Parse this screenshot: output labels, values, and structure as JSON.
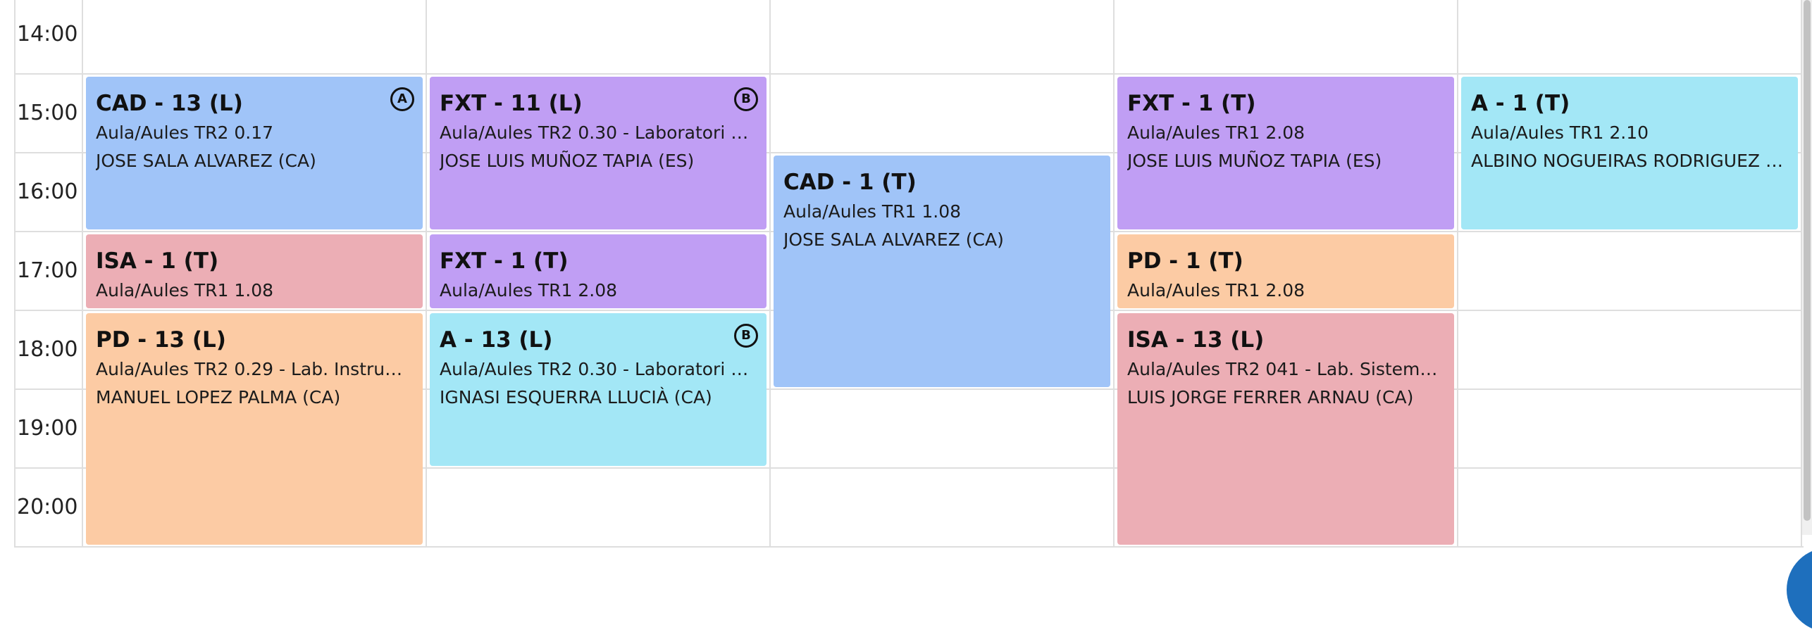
{
  "colors": {
    "blue": "#a0c4f8",
    "purple": "#c09ef4",
    "pink": "#ecaeb5",
    "orange": "#fccba4",
    "cyan": "#a3e7f6",
    "grid": "#dedede",
    "accent": "#1e6fbd"
  },
  "time_labels": [
    "14:00",
    "15:00",
    "16:00",
    "17:00",
    "18:00",
    "19:00",
    "20:00"
  ],
  "events": [
    {
      "day": 0,
      "start": 15,
      "end": 17,
      "color": "blue",
      "title": "CAD - 13 (L)",
      "badge": "A",
      "lines": [
        "Aula/Aules TR2 0.17",
        "JOSE SALA ALVAREZ (CA)"
      ]
    },
    {
      "day": 0,
      "start": 17,
      "end": 18,
      "color": "pink",
      "title": "ISA - 1 (T)",
      "badge": "",
      "lines": [
        "Aula/Aules TR1 1.08"
      ]
    },
    {
      "day": 0,
      "start": 18,
      "end": 21,
      "color": "orange",
      "title": "PD - 13 (L)",
      "badge": "",
      "lines": [
        "Aula/Aules TR2 0.29 - Lab. Instrum....",
        "MANUEL LOPEZ PALMA (CA)"
      ]
    },
    {
      "day": 1,
      "start": 15,
      "end": 17,
      "color": "purple",
      "title": "FXT - 11 (L)",
      "badge": "B",
      "lines": [
        "Aula/Aules TR2 0.30 - Laboratori À...",
        "JOSE LUIS MUÑOZ TAPIA (ES)"
      ]
    },
    {
      "day": 1,
      "start": 17,
      "end": 18,
      "color": "purple",
      "title": "FXT - 1 (T)",
      "badge": "",
      "lines": [
        "Aula/Aules TR1 2.08"
      ]
    },
    {
      "day": 1,
      "start": 18,
      "end": 20,
      "color": "cyan",
      "title": "A - 13 (L)",
      "badge": "B",
      "lines": [
        "Aula/Aules TR2 0.30 - Laboratori À...",
        "IGNASI ESQUERRA LLUCIÀ (CA)"
      ]
    },
    {
      "day": 2,
      "start": 16,
      "end": 19,
      "color": "blue",
      "title": "CAD - 1 (T)",
      "badge": "",
      "lines": [
        "Aula/Aules TR1 1.08",
        "JOSE SALA ALVAREZ (CA)"
      ]
    },
    {
      "day": 3,
      "start": 15,
      "end": 17,
      "color": "purple",
      "title": "FXT - 1 (T)",
      "badge": "",
      "lines": [
        "Aula/Aules TR1 2.08",
        "JOSE LUIS MUÑOZ TAPIA (ES)"
      ]
    },
    {
      "day": 3,
      "start": 17,
      "end": 18,
      "color": "orange",
      "title": "PD - 1 (T)",
      "badge": "",
      "lines": [
        "Aula/Aules TR1 2.08"
      ]
    },
    {
      "day": 3,
      "start": 18,
      "end": 21,
      "color": "pink",
      "title": "ISA - 13 (L)",
      "badge": "",
      "lines": [
        "Aula/Aules TR2 041 - Lab. Sistemes...",
        "LUIS JORGE FERRER ARNAU (CA)"
      ]
    },
    {
      "day": 4,
      "start": 15,
      "end": 17,
      "color": "cyan",
      "title": "A - 1 (T)",
      "badge": "",
      "lines": [
        "Aula/Aules TR1 2.10",
        "ALBINO NOGUEIRAS RODRIGUEZ (..."
      ]
    }
  ]
}
